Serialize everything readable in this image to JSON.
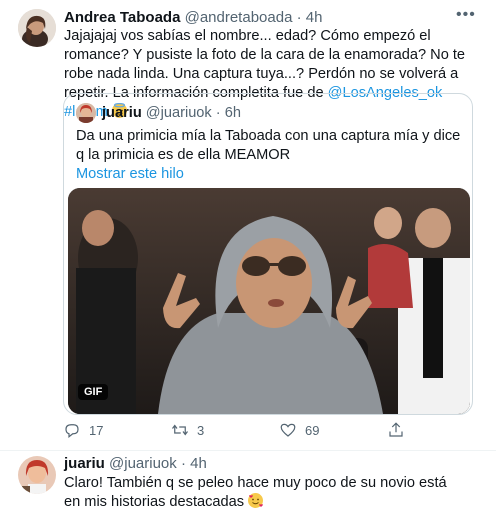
{
  "tweet1": {
    "display_name": "Andrea Taboada",
    "handle": "@andretaboada",
    "sep": "·",
    "time": "4h",
    "text_part1": "Jajajajaj vos sabías el nombre... edad? Cómo empezó el romance? Y pusiste la foto de la cara de la enamorada? No te robe nada linda. Una captura tuya...? Perdón no se volverá a repetir. La información completita fue de ",
    "mention": "@LosAngeles_ok",
    "hashtag": "#lamm",
    "emoji": "smiling-face-with-halo",
    "actions": {
      "replies": "17",
      "retweets": "3",
      "likes": "69"
    }
  },
  "quote": {
    "display_name": "juariu",
    "handle": "@juariuok",
    "sep": "·",
    "time": "6h",
    "text": "Da una primicia mía la Taboada con una captura mía y dice q la primicia es de ella MEAMOR",
    "show_thread": "Mostrar este hilo",
    "gif_label": "GIF"
  },
  "tweet2": {
    "display_name": "juariu",
    "handle": "@juariuok",
    "sep": "·",
    "time": "4h",
    "text": "Claro! También q se peleo hace muy poco de su novio está en mis historias destacadas",
    "emoji": "smiling-face-with-hearts"
  },
  "colors": {
    "link": "#1b95e0",
    "muted": "#536471",
    "border": "#cfd9de"
  }
}
